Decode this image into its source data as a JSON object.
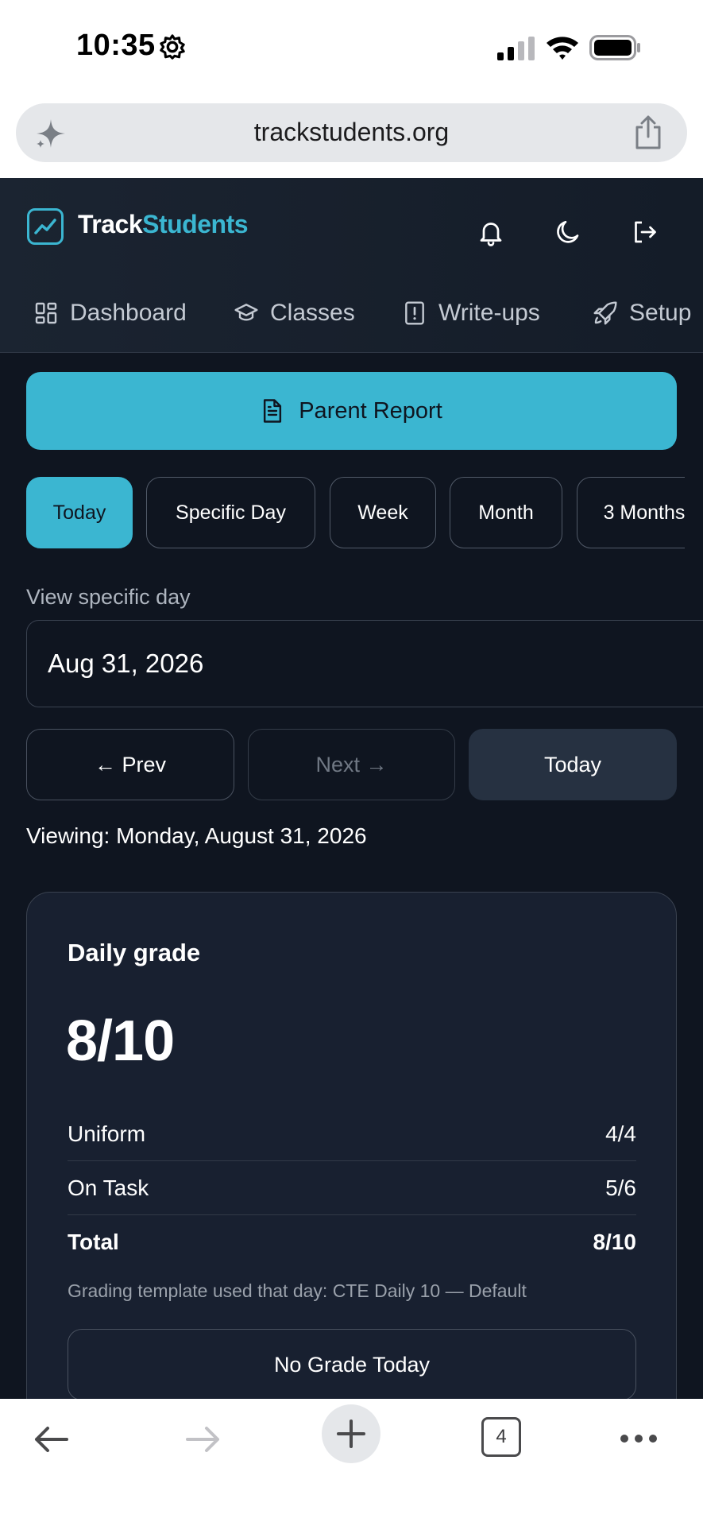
{
  "status_bar": {
    "time": "10:35"
  },
  "browser": {
    "url": "trackstudents.org",
    "tab_count": "4"
  },
  "app": {
    "logo_part1": "Track",
    "logo_part2": "Students",
    "nav": [
      {
        "label": "Dashboard",
        "icon": "grid-icon"
      },
      {
        "label": "Classes",
        "icon": "graduation-cap-icon"
      },
      {
        "label": "Write-ups",
        "icon": "alert-file-icon"
      },
      {
        "label": "Setup",
        "icon": "rocket-icon"
      }
    ],
    "parent_report_label": "Parent Report",
    "range_tabs": [
      "Today",
      "Specific Day",
      "Week",
      "Month",
      "3 Months"
    ],
    "specific_day_label": "View specific day",
    "date_value": "Aug 31, 2026",
    "prev_label": "← Prev",
    "next_label": "Next →",
    "today_label": "Today",
    "viewing_text": "Viewing: Monday, August 31, 2026",
    "card": {
      "title": "Daily grade",
      "score": "8/10",
      "rows": [
        {
          "label": "Uniform",
          "value": "4/4"
        },
        {
          "label": "On Task",
          "value": "5/6"
        },
        {
          "label": "Total",
          "value": "8/10"
        }
      ],
      "template_note": "Grading template used that day: CTE Daily 10 — Default",
      "no_grade_label": "No Grade Today"
    }
  },
  "colors": {
    "accent": "#3bb6d1",
    "background": "#0f1520",
    "card": "#182030"
  }
}
